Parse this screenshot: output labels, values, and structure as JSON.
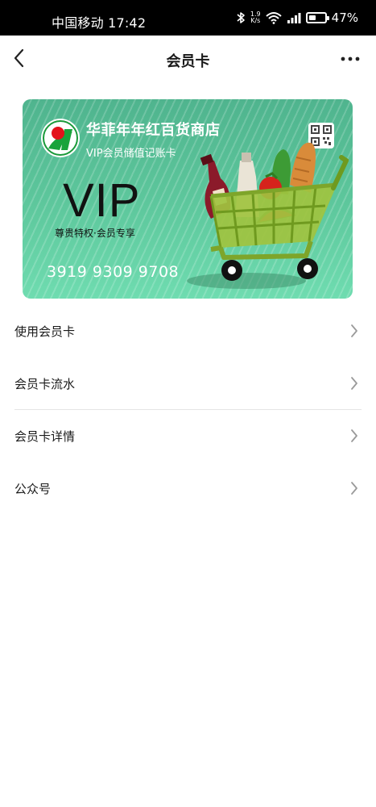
{
  "status_bar": {
    "carrier_time": "中国移动 17:42",
    "net_speed_value": "1.9",
    "net_speed_unit": "K/s",
    "battery_level": 0.47,
    "battery_text": "47%",
    "icons": [
      "bluetooth-icon",
      "wifi-icon",
      "signal-icon",
      "battery-icon"
    ]
  },
  "nav": {
    "title": "会员卡",
    "back_icon": "chevron-left-icon",
    "more_icon": "more-icon"
  },
  "card": {
    "store_name": "华菲年年红百货商店",
    "card_type": "VIP会员储值记账卡",
    "vip_label": "VIP",
    "slogan": "尊贵特权·会员专享",
    "card_number": "3919 9309 9708",
    "logo_icon": "store-logo-icon",
    "qr_icon": "qr-code-icon",
    "illustration": "shopping-cart-illustration",
    "colors": {
      "card_top": "#4fb48e",
      "card_bottom": "#6fdcb0"
    }
  },
  "menu": {
    "items": [
      {
        "label": "使用会员卡"
      },
      {
        "label": "会员卡流水"
      },
      {
        "label": "会员卡详情"
      },
      {
        "label": "公众号"
      }
    ],
    "arrow_icon": "chevron-right-icon"
  }
}
